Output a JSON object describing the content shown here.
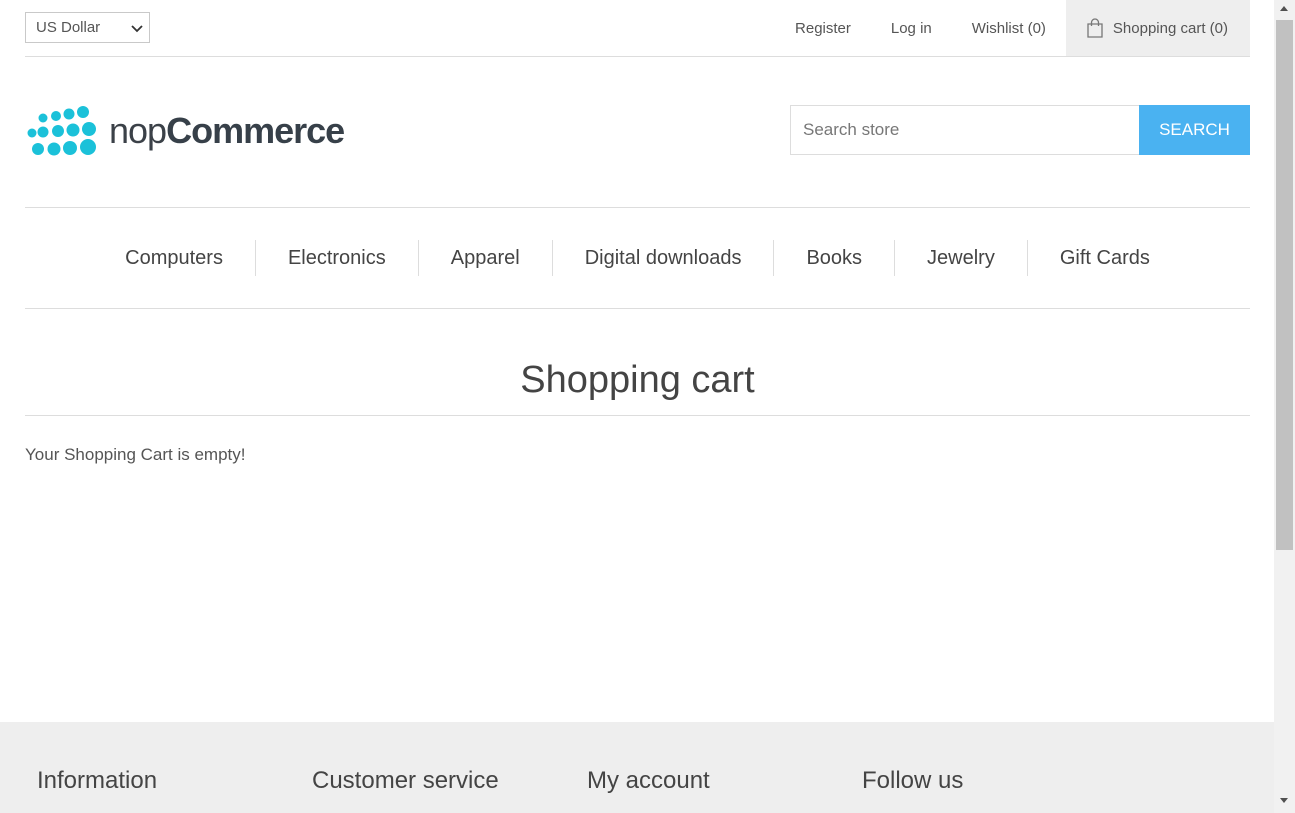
{
  "header": {
    "currency": {
      "selected": "US Dollar"
    },
    "links": {
      "register": "Register",
      "login": "Log in",
      "wishlist": "Wishlist (0)",
      "cart": "Shopping cart (0)"
    }
  },
  "logo": {
    "text_light": "nop",
    "text_bold": "Commerce",
    "dot_color": "#1bc1d9"
  },
  "search": {
    "placeholder": "Search store",
    "button_label": "Search",
    "button_color": "#4ab2f1"
  },
  "menu": {
    "items": [
      "Computers",
      "Electronics",
      "Apparel",
      "Digital downloads",
      "Books",
      "Jewelry",
      "Gift Cards"
    ]
  },
  "main": {
    "title": "Shopping cart",
    "empty_message": "Your Shopping Cart is empty!"
  },
  "footer": {
    "columns": [
      "Information",
      "Customer service",
      "My account",
      "Follow us"
    ]
  }
}
